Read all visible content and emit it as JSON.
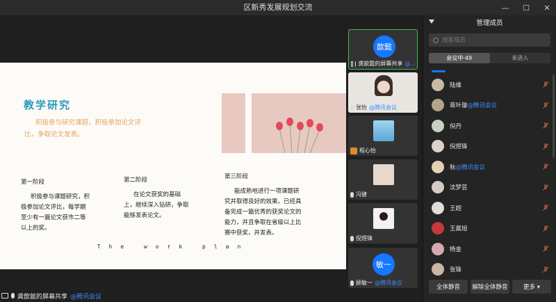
{
  "window": {
    "title": "区新秀发展规划交流"
  },
  "slide": {
    "title": "教学研究",
    "intro": "积极参与研究课题，积极参加论文评比，争取论文发表。",
    "stages": [
      {
        "heading": "第一阶段",
        "body": "积极参与课题研究，积极参加论文评比，每学期至少有一篇论文获市二等以上的奖。"
      },
      {
        "heading": "第二阶段",
        "body": "在论文获奖的基础上，继续深入钻研，争取能够发表论文。"
      },
      {
        "heading": "第三阶段",
        "body": "能成熟地进行一项课题研究并取得良好的效果。已经具备完成一篇优秀的获奖论文的能力，并且争取在省级以上比赛中获奖，并发表。"
      }
    ],
    "footer": "The work plan"
  },
  "presenter": {
    "name": "龚歆懿的屏幕共享",
    "org": "@腾讯会议"
  },
  "video_tiles": [
    {
      "avatar_text": "歆懿",
      "name": "龚歆懿的屏幕共享",
      "org": "@..."
    },
    {
      "name": "张怡",
      "org": "@腾讯会议"
    },
    {
      "name": "程心怡"
    },
    {
      "name": "冯健"
    },
    {
      "name": "倪煜锋"
    },
    {
      "avatar_text": "敏一",
      "name": "顾敏一",
      "org": "@腾讯会议"
    }
  ],
  "panel": {
    "title": "管理成员",
    "search_placeholder": "搜索成员",
    "tabs": [
      "会议中·49",
      "未进入"
    ],
    "members": [
      {
        "name": "陆维",
        "org": "",
        "color": "#c9b9a6"
      },
      {
        "name": "蒋叶璇",
        "org": "@腾讯会议",
        "color": "#b5a48c"
      },
      {
        "name": "倪丹",
        "org": "",
        "color": "#c8d0c6"
      },
      {
        "name": "倪煜锋",
        "org": "",
        "color": "#ddd3cc"
      },
      {
        "name": "秋",
        "org": "@腾讯会议",
        "color": "#e3d1b6"
      },
      {
        "name": "沈梦芸",
        "org": "",
        "color": "#d6cbc4"
      },
      {
        "name": "王超",
        "org": "",
        "color": "#e0ddd8"
      },
      {
        "name": "王晨旭",
        "org": "",
        "color": "#c43a3a"
      },
      {
        "name": "杨金",
        "org": "",
        "color": "#d8a8b0"
      },
      {
        "name": "张锋",
        "org": "",
        "color": "#c8b6a6"
      }
    ],
    "buttons": {
      "mute_all": "全体静音",
      "unmute_all": "解除全体静音",
      "more": "更多 ▾"
    }
  }
}
